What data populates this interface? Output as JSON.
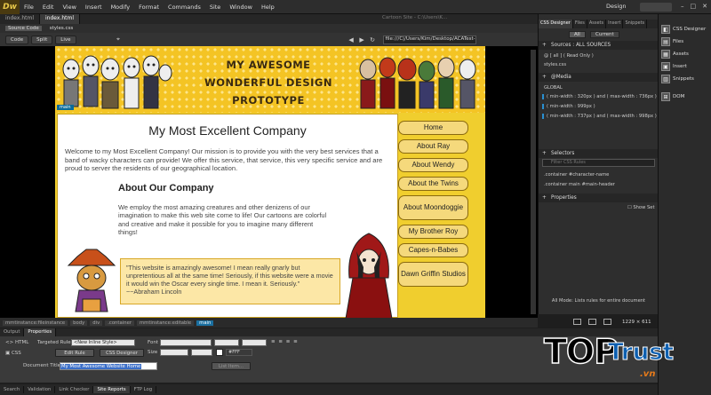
{
  "app": {
    "logo": "Dw",
    "menu": [
      "File",
      "Edit",
      "View",
      "Insert",
      "Modify",
      "Format",
      "Commands",
      "Site",
      "Window",
      "Help"
    ],
    "workspace": "Design",
    "window_controls": [
      "–",
      "□",
      "✕"
    ]
  },
  "doc_tabs": [
    "index.html",
    "index.html"
  ],
  "doc_path": "Cartoon Site - C:\\Users\\K...",
  "related_files": [
    "Source Code",
    "styles.css"
  ],
  "view_bar": {
    "code": "Code",
    "split": "Split",
    "live": "Live",
    "url": "file:///C|/Users/Kim/Desktop/ACATest-Prep/car"
  },
  "page": {
    "header_lines": [
      "MY AWESOME",
      "WONDERFUL DESIGN",
      "PROTOTYPE"
    ],
    "main_badge": "main",
    "title": "My Most Excellent Company",
    "intro": "Welcome to my Most Excellent Company! Our mission is to provide you with the very best services that a band of wacky characters can provide! We offer this service, that service, this very specific service and are proud to server the residents of our geographical location.",
    "about_heading": "About Our Company",
    "about_text": "We employ the most amazing creatures and other denizens of our imagination to make this web site come to life! Our cartoons are colorful and creative and make it possible for you to imagine many different things!",
    "quote": "\"This website is amazingly awesome! I mean really gnarly but unpretentious all at the same time! Seriously, if this website were a movie it would win the Oscar every single time. I mean it. Seriously.\" ~~Abraham Lincoln",
    "nav": [
      "Home",
      "About Ray",
      "About Wendy",
      "About the Twins",
      "About Moondoggie",
      "My Brother Roy",
      "Capes-n-Babes",
      "Dawn Griffin Studios"
    ]
  },
  "tag_selector": [
    "mmtinstance:fileinstance",
    "body",
    "div",
    ".container",
    "mmtinstance:editable",
    "main"
  ],
  "window_size": "1229 × 611",
  "properties": {
    "tabs": [
      "Output",
      "Properties"
    ],
    "html_btn": "HTML",
    "css_btn": "CSS",
    "targeted_rule_label": "Targeted Rule",
    "targeted_rule_value": "<New Inline Style>",
    "edit_rule": "Edit Rule",
    "css_designer": "CSS Designer",
    "font_label": "Font",
    "size_label": "Size",
    "color_value": "#FFF",
    "doc_title_label": "Document Title",
    "doc_title_value": "My Most Awesome Website Home",
    "list_item": "List Item..."
  },
  "bottom_tabs": [
    "Search",
    "Validation",
    "Link Checker",
    "Site Reports",
    "FTP Log"
  ],
  "css_designer": {
    "tabs": [
      "CSS Designer",
      "Files",
      "Assets",
      "Insert",
      "Snippets"
    ],
    "all": "All",
    "current": "Current",
    "sources_head": "Sources : ALL SOURCES",
    "sources": [
      "@ [ all ] ( Read Only )",
      "styles.css"
    ],
    "media_head": "@Media",
    "media_global": "GLOBAL",
    "media": [
      "( min-width : 320px ) and ( max-width : 736px )",
      "( min-width : 999px )",
      "( min-width : 737px ) and ( max-width : 998px )"
    ],
    "selectors_head": "Selectors",
    "filter_placeholder": "Filter CSS Rules",
    "selectors": [
      ".container #character-name",
      ".container main #main-header"
    ],
    "properties_head": "Properties",
    "show_set": "Show Set",
    "footer": "All Mode: Lists rules for entire document"
  },
  "right_toolbar": [
    "CSS Designer",
    "Files",
    "Assets",
    "Insert",
    "Snippets",
    "DOM"
  ],
  "watermark": {
    "top": "TOP",
    "trust": "Trust",
    "vn": ".vn"
  },
  "colors": {
    "accent": "#1a6fa0",
    "page_yellow": "#f0ce2e",
    "nav_button": "#f5d97c"
  }
}
